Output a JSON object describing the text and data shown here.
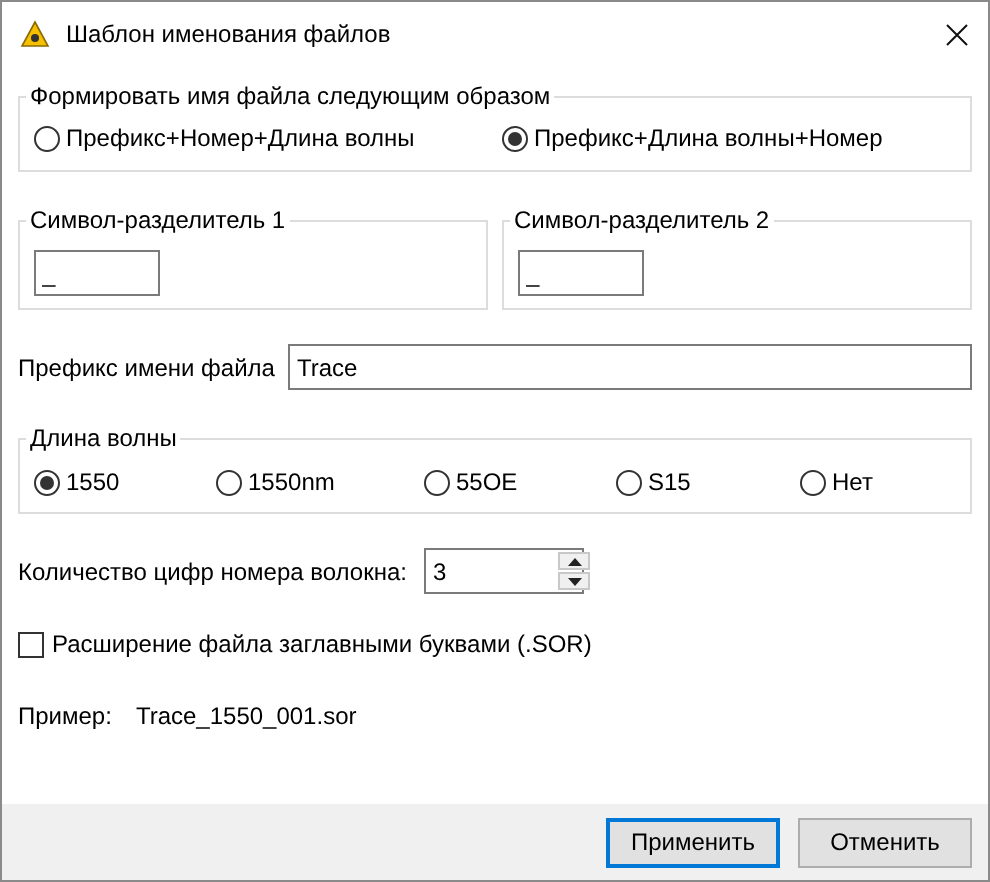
{
  "window": {
    "title": "Шаблон именования файлов"
  },
  "format_group": {
    "legend": "Формировать имя файла следующим образом",
    "options": [
      {
        "label": "Префикс+Номер+Длина волны",
        "selected": false
      },
      {
        "label": "Префикс+Длина волны+Номер",
        "selected": true
      }
    ]
  },
  "separators": [
    {
      "legend": "Символ-разделитель 1",
      "value": "_"
    },
    {
      "legend": "Символ-разделитель 2",
      "value": "_"
    }
  ],
  "prefix": {
    "label": "Префикс имени файла",
    "value": "Trace"
  },
  "wavelength_group": {
    "legend": "Длина волны",
    "options": [
      {
        "label": "1550",
        "selected": true
      },
      {
        "label": "1550nm",
        "selected": false
      },
      {
        "label": "55OE",
        "selected": false
      },
      {
        "label": "S15",
        "selected": false
      },
      {
        "label": "Нет",
        "selected": false
      }
    ]
  },
  "digits": {
    "label": "Количество цифр номера волокна:",
    "value": "3"
  },
  "uppercase_extension": {
    "label": "Расширение файла заглавными буквами (.SOR)",
    "checked": false
  },
  "example": {
    "label": "Пример:",
    "value": "Trace_1550_001.sor"
  },
  "buttons": [
    {
      "label": "Применить",
      "focused": true
    },
    {
      "label": "Отменить",
      "focused": false
    }
  ]
}
